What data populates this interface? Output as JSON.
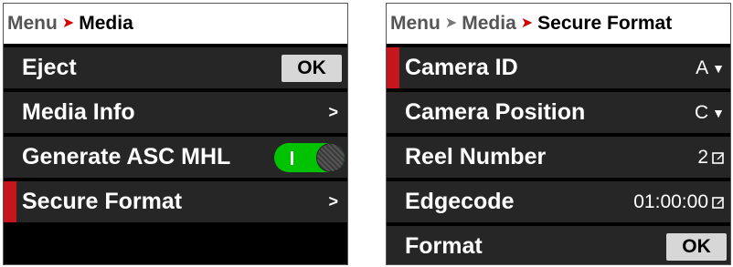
{
  "left": {
    "breadcrumb": {
      "menu": "Menu",
      "current": "Media"
    },
    "rows": {
      "eject": {
        "label": "Eject",
        "button": "OK"
      },
      "media_info": {
        "label": "Media Info",
        "chevron": ">"
      },
      "generate_mhl": {
        "label": "Generate ASC MHL",
        "toggle_on": true
      },
      "secure_format": {
        "label": "Secure Format",
        "chevron": ">"
      }
    }
  },
  "right": {
    "breadcrumb": {
      "menu": "Menu",
      "media": "Media",
      "current": "Secure Format"
    },
    "rows": {
      "camera_id": {
        "label": "Camera ID",
        "value": "A"
      },
      "camera_position": {
        "label": "Camera Position",
        "value": "C"
      },
      "reel_number": {
        "label": "Reel Number",
        "value": "2"
      },
      "edgecode": {
        "label": "Edgecode",
        "value": "01:00:00"
      },
      "format": {
        "label": "Format",
        "button": "OK"
      }
    }
  },
  "colors": {
    "accent_red": "#c4161c",
    "toggle_green": "#00c200",
    "row_bg": "#262626",
    "panel_bg": "#000000"
  },
  "icons": {
    "submenu": "chevron-right-icon",
    "dropdown": "chevron-down-icon",
    "edit": "edit-icon"
  }
}
